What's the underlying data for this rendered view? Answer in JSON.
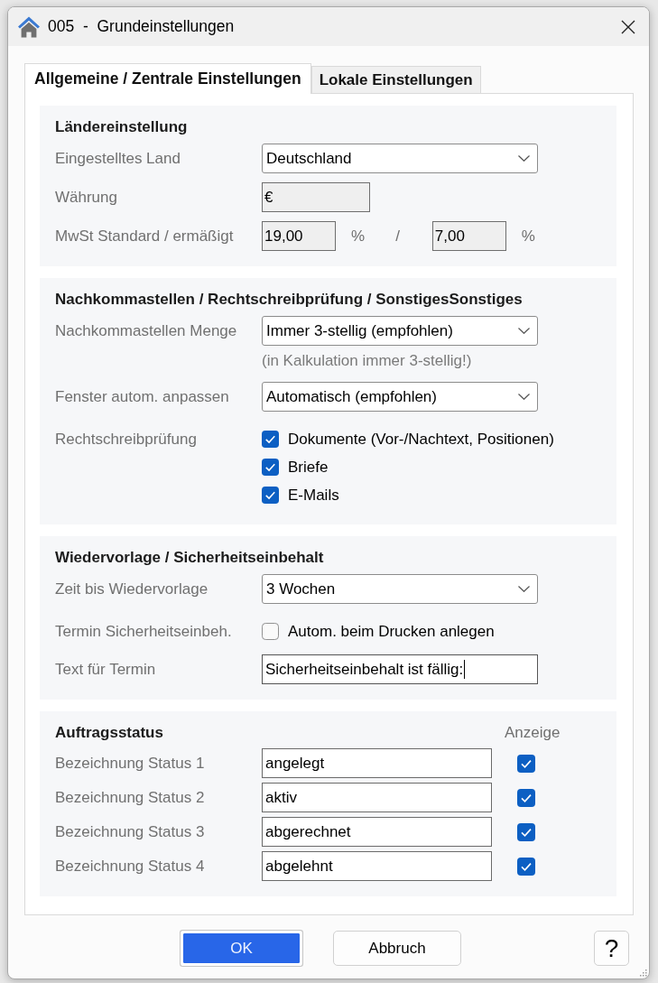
{
  "window": {
    "title": "005  -  Grundeinstellungen"
  },
  "tabs": [
    {
      "label": "Allgemeine / Zentrale Einstellungen",
      "selected": true
    },
    {
      "label": "Lokale Einstellungen",
      "selected": false
    }
  ],
  "sections": [
    {
      "kind": "form",
      "title": "Ländereinstellung",
      "rows": [
        {
          "kind": "dropdown",
          "label": "Eingestelltes Land",
          "value": "Deutschland"
        },
        {
          "kind": "readonly",
          "label": "Währung",
          "value": "€"
        },
        {
          "kind": "pair",
          "label": "MwSt Standard / ermäßigt",
          "separator": "/",
          "fields": [
            {
              "value": "19,00",
              "unit": "%"
            },
            {
              "value": "7,00",
              "unit": "%"
            }
          ]
        }
      ]
    },
    {
      "kind": "form",
      "title": "Nachkommastellen / Rechtschreibprüfung / SonstigesSonstiges",
      "rows": [
        {
          "kind": "dropdown",
          "label": "Nachkommastellen Menge",
          "value": "Immer 3-stellig (empfohlen)",
          "hint": "(in Kalkulation immer 3-stellig!)"
        },
        {
          "kind": "dropdown",
          "label": "Fenster autom. anpassen",
          "value": "Automatisch (empfohlen)"
        },
        {
          "kind": "checklist",
          "label": "Rechtschreibprüfung",
          "options": [
            {
              "label": "Dokumente (Vor-/Nachtext, Positionen)",
              "checked": true
            },
            {
              "label": "Briefe",
              "checked": true
            },
            {
              "label": "E-Mails",
              "checked": true
            }
          ]
        }
      ]
    },
    {
      "kind": "form",
      "title": "Wiedervorlage / Sicherheitseinbehalt",
      "rows": [
        {
          "kind": "dropdown",
          "label": "Zeit bis Wiedervorlage",
          "value": "3 Wochen"
        },
        {
          "kind": "checklist",
          "label": "Termin Sicherheitseinbeh.",
          "options": [
            {
              "label": "Autom. beim Drucken anlegen",
              "checked": false
            }
          ]
        },
        {
          "kind": "text",
          "label": "Text für Termin",
          "value": "Sicherheitseinbehalt ist fällig:",
          "focused": true
        }
      ]
    },
    {
      "kind": "status_table",
      "title": "Auftragsstatus",
      "column_header": "Anzeige",
      "rows": [
        {
          "label": "Bezeichnung Status 1",
          "value": "angelegt",
          "checked": true
        },
        {
          "label": "Bezeichnung Status 2",
          "value": "aktiv",
          "checked": true
        },
        {
          "label": "Bezeichnung Status 3",
          "value": "abgerechnet",
          "checked": true
        },
        {
          "label": "Bezeichnung Status 4",
          "value": "abgelehnt",
          "checked": true
        }
      ]
    }
  ],
  "buttons": [
    {
      "label": "OK",
      "default": true
    },
    {
      "label": "Abbruch",
      "default": false
    }
  ],
  "help_button": {
    "label": "?"
  }
}
